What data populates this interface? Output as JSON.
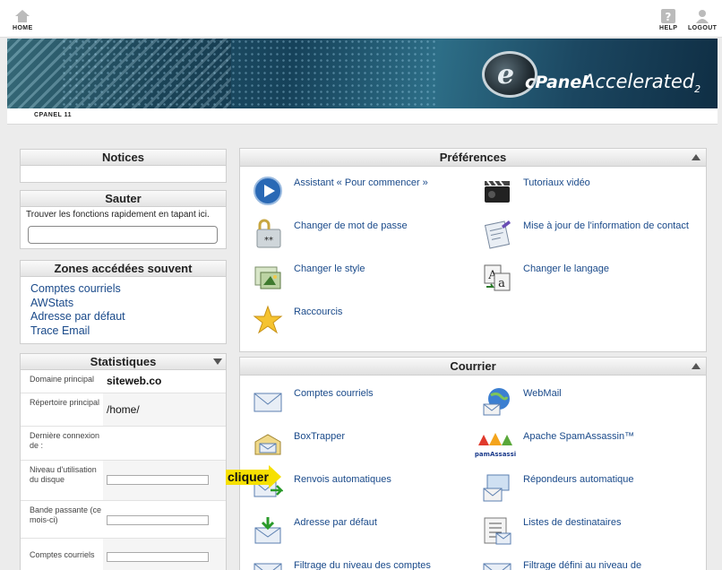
{
  "topnav": {
    "home": "HOME",
    "help": "HELP",
    "logout": "LOGOUT"
  },
  "banner": {
    "logo_letter": "e",
    "brand_main": "cPanel",
    "brand_accent": "Accelerated",
    "brand_version": "2"
  },
  "breadcrumb": "CPANEL 11",
  "notices": {
    "title": "Notices"
  },
  "jump": {
    "title": "Sauter",
    "hint": "Trouver les fonctions rapidement en tapant ici.",
    "value": ""
  },
  "frequent": {
    "title": "Zones accédées souvent",
    "links": [
      "Comptes courriels",
      "AWStats",
      "Adresse par défaut",
      "Trace Email"
    ]
  },
  "stats": {
    "title": "Statistiques",
    "rows": [
      {
        "label": "Domaine principal",
        "value": "siteweb.co"
      },
      {
        "label": "Répertoire principal",
        "value": "/home/"
      },
      {
        "label": "Dernière connexion de :",
        "value": ""
      },
      {
        "label": "Niveau d'utilisation du disque",
        "value": ""
      },
      {
        "label": "Bande passante (ce mois-ci)",
        "value": ""
      },
      {
        "label": "Comptes courriels",
        "value": ""
      }
    ]
  },
  "preferences": {
    "title": "Préférences",
    "items": [
      {
        "label": "Assistant « Pour commencer »",
        "icon": "play-icon"
      },
      {
        "label": "Tutoriaux vidéo",
        "icon": "video-clapper-icon"
      },
      {
        "label": "Changer de mot de passe",
        "icon": "password-lock-icon"
      },
      {
        "label": "Mise à jour de l'information de contact",
        "icon": "contact-form-icon"
      },
      {
        "label": "Changer le style",
        "icon": "style-icon"
      },
      {
        "label": "Changer le langage",
        "icon": "language-icon"
      },
      {
        "label": "Raccourcis",
        "icon": "star-icon"
      }
    ]
  },
  "mail": {
    "title": "Courrier",
    "items": [
      {
        "label": "Comptes courriels",
        "icon": "envelope-icon"
      },
      {
        "label": "WebMail",
        "icon": "globe-mail-icon"
      },
      {
        "label": "BoxTrapper",
        "icon": "boxtrapper-icon"
      },
      {
        "label": "Apache SpamAssassin™",
        "icon": "spamassassin-icon",
        "badge": "SpamAssassin"
      },
      {
        "label": "Renvois automatiques",
        "icon": "forward-mail-icon"
      },
      {
        "label": "Répondeurs automatique",
        "icon": "autoresponder-icon"
      },
      {
        "label": "Adresse par défaut",
        "icon": "default-address-icon"
      },
      {
        "label": "Listes de destinataires",
        "icon": "mailing-list-icon"
      },
      {
        "label": "Filtrage du niveau des comptes",
        "icon": "account-filter-icon"
      },
      {
        "label": "Filtrage défini au niveau de",
        "icon": "user-filter-icon"
      }
    ]
  },
  "annotation": {
    "label": "cliquer"
  },
  "colors": {
    "link": "#1a4a8a",
    "callout": "#f6e000",
    "header_bg": "#e4e4e4"
  }
}
